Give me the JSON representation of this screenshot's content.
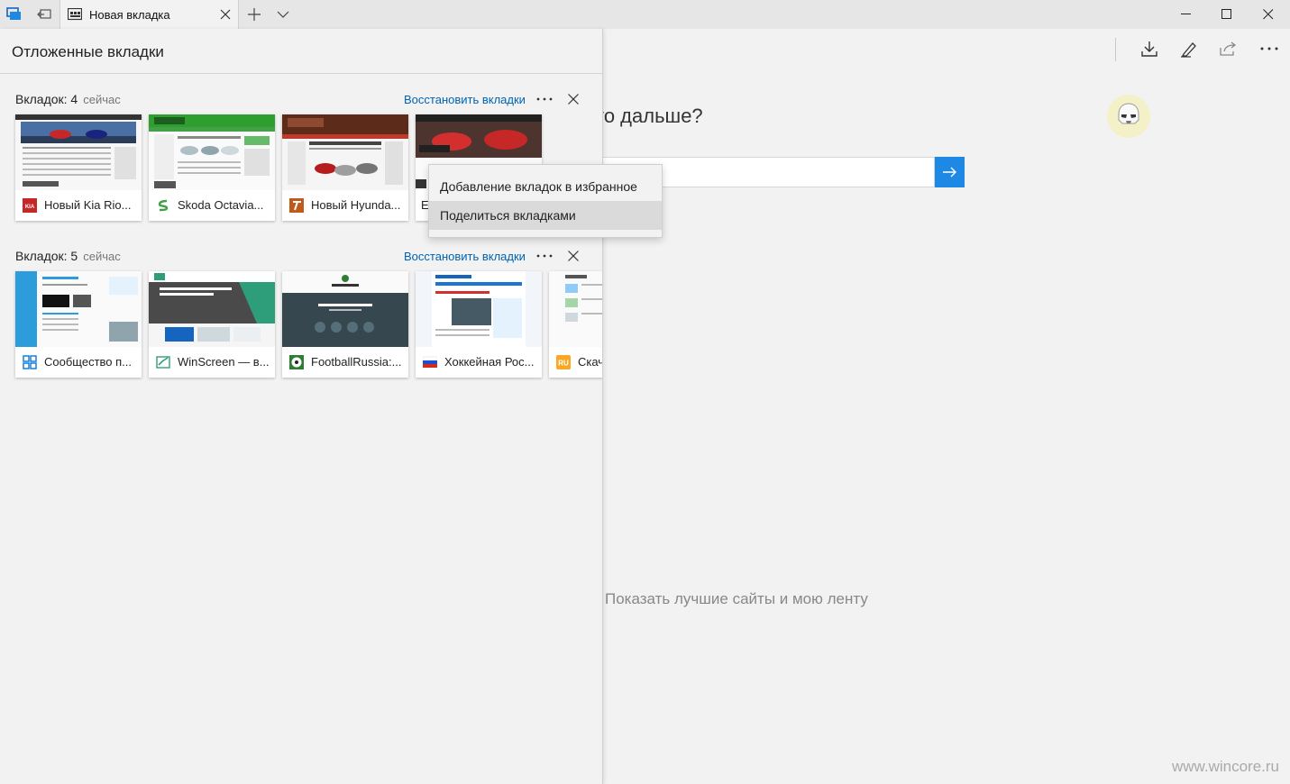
{
  "titlebar": {
    "tab_title": "Новая вкладка"
  },
  "panel": {
    "title": "Отложенные вкладки",
    "groups": [
      {
        "count_label": "Вкладок: 4",
        "time_label": "сейчас",
        "restore_label": "Восстановить вкладки",
        "tabs": [
          {
            "label": "Новый Kia Rio...",
            "favicon": "kia-icon"
          },
          {
            "label": "Skoda Octavia...",
            "favicon": "drom-icon"
          },
          {
            "label": "Новый Hyunda...",
            "favicon": "tucson-icon"
          },
          {
            "label": "E",
            "favicon": "blank-icon"
          }
        ]
      },
      {
        "count_label": "Вкладок: 5",
        "time_label": "сейчас",
        "restore_label": "Восстановить вкладки",
        "tabs": [
          {
            "label": "Сообщество п...",
            "favicon": "windows-icon"
          },
          {
            "label": "WinScreen — в...",
            "favicon": "winscreen-icon"
          },
          {
            "label": "FootballRussia:...",
            "favicon": "football-icon"
          },
          {
            "label": "Хоккейная Рос...",
            "favicon": "russia-flag-icon"
          },
          {
            "label": "Скач",
            "favicon": "ru-icon"
          }
        ]
      }
    ]
  },
  "context_menu": {
    "items": [
      {
        "label": "Добавление вкладок в избранное"
      },
      {
        "label": "Поделиться вкладками"
      }
    ]
  },
  "ntp": {
    "question": "то дальше?",
    "show_label": "Показать лучшие сайты и мою ленту"
  },
  "watermark": "www.wincore.ru",
  "colors": {
    "accent": "#1e88e5",
    "link": "#0063b1"
  }
}
